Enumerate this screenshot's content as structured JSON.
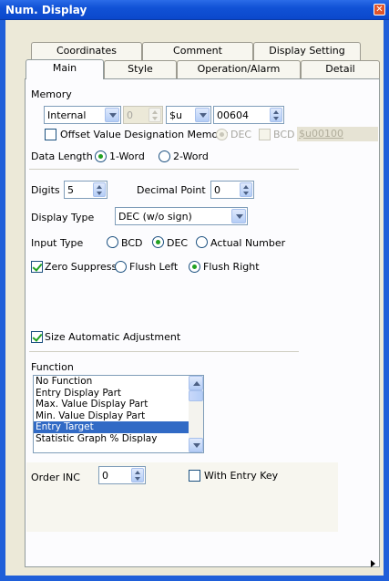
{
  "window": {
    "title": "Num. Display",
    "close_symbol": "✕"
  },
  "tabs_row1": [
    "Coordinates",
    "Comment",
    "Display Setting"
  ],
  "tabs_row2": [
    "Main",
    "Style",
    "Operation/Alarm",
    "Detail"
  ],
  "active_tab": "Main",
  "memory": {
    "section_label": "Memory",
    "device": "Internal",
    "station": "0",
    "type": "$u",
    "address": "00604",
    "offset_label": "Offset Value Designation Memory",
    "offset_checked": false,
    "offset_dec_label": "DEC",
    "offset_bcd_label": "BCD",
    "offset_address": "$u00100"
  },
  "data_length": {
    "label": "Data Length",
    "opt1": "1-Word",
    "opt2": "2-Word",
    "selected": "1-Word"
  },
  "digits": {
    "label": "Digits",
    "value": "5"
  },
  "decimal_point": {
    "label": "Decimal Point",
    "value": "0"
  },
  "display_type": {
    "label": "Display Type",
    "value": "DEC (w/o sign)"
  },
  "input_type": {
    "label": "Input Type",
    "opt1": "BCD",
    "opt2": "DEC",
    "opt3": "Actual Number",
    "selected": "DEC"
  },
  "zero_suppress": {
    "label": "Zero Suppress",
    "checked": true,
    "left_label": "Flush Left",
    "right_label": "Flush Right",
    "selected": "Flush Right"
  },
  "size_auto": {
    "label": "Size Automatic Adjustment",
    "checked": true
  },
  "function": {
    "label": "Function",
    "items": [
      "No Function",
      "Entry Display Part",
      "Max. Value Display Part",
      "Min. Value Display Part",
      "Entry Target",
      "Statistic Graph % Display"
    ],
    "selected": "Entry Target"
  },
  "order_inc": {
    "label": "Order INC",
    "value": "0"
  },
  "with_entry_key": {
    "label": "With Entry Key",
    "checked": false
  },
  "colors": {
    "title_bar": "#0b48cc",
    "selection": "#316ac5",
    "check_green": "#21a121"
  }
}
